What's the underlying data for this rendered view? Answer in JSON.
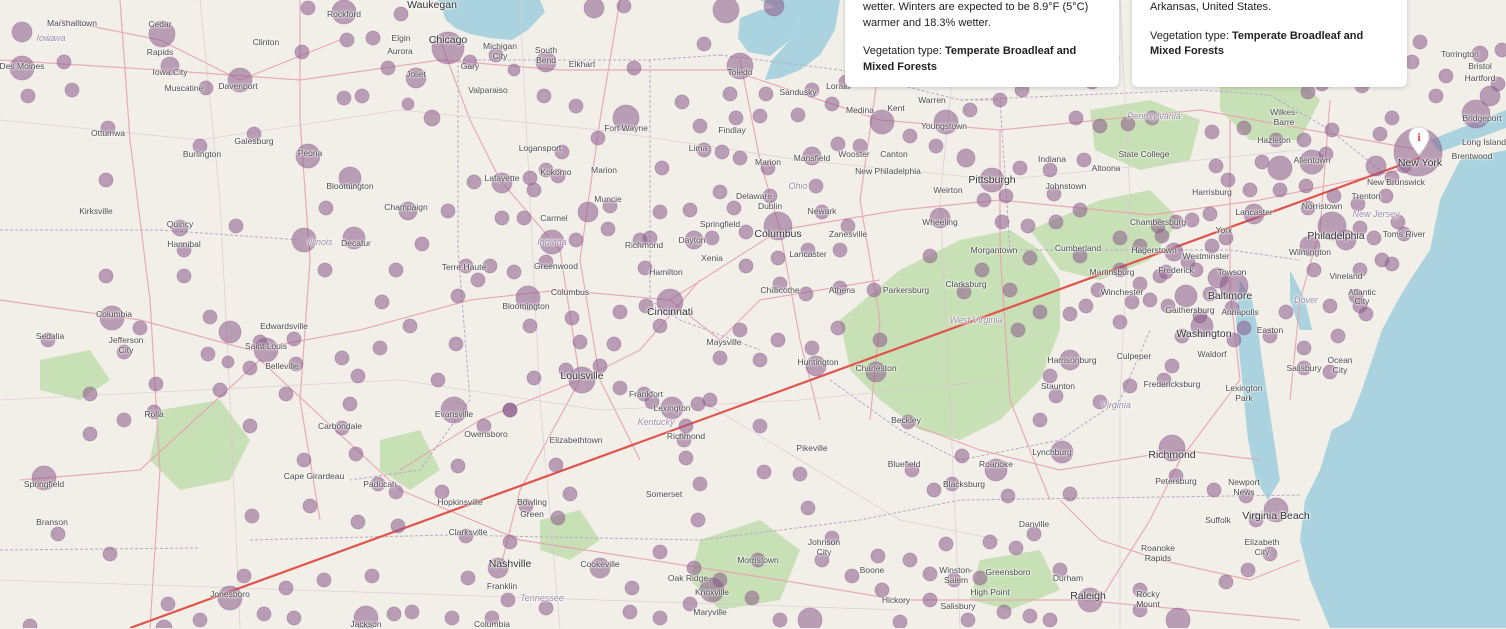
{
  "cards": [
    {
      "line1": "wetter. Winters are expected to be 8.9°F (5°C)",
      "line2": "warmer and 18.3% wetter.",
      "veg_prefix": "Vegetation type: ",
      "veg_bold": "Temperate Broadleaf and Mixed Forests"
    },
    {
      "line1": "Arkansas, United States.",
      "veg_prefix": "Vegetation type: ",
      "veg_bold": "Temperate Broadleaf and Mixed Forests"
    }
  ],
  "pin_icon": "info-marker-icon",
  "route_color": "#e0544d",
  "cluster_color": "#8a5a8a",
  "labels": {
    "big": [
      "Chicago",
      "Columbus",
      "Louisville",
      "Baltimore",
      "Washington",
      "Philadelphia",
      "Richmond",
      "Nashville",
      "Virginia Beach",
      "New York",
      "Cincinnati",
      "Pittsburgh"
    ],
    "small": [
      "Marshalltown",
      "Cedar Rapids",
      "Iowa City",
      "Des Moines",
      "Muscatine",
      "Davenport",
      "Rockford",
      "Elgin",
      "Aurora",
      "Joliet",
      "Gary",
      "Waukegan",
      "Michigan City",
      "South Bend",
      "Elkhart",
      "Valparaiso",
      "Toledo",
      "Fort Wayne",
      "Findlay",
      "Lima",
      "Sandusky",
      "Mansfield",
      "Kent",
      "Youngstown",
      "Canton",
      "Wooster",
      "Medina",
      "Warren",
      "New Philadelphia",
      "Wheeling",
      "Weirton",
      "Indiana",
      "Johnstown",
      "Altoona",
      "State College",
      "Harrisburg",
      "Lancaster",
      "York",
      "Allentown",
      "Trenton",
      "New Brunswick",
      "Wilmington",
      "Hagerstown",
      "Frederick",
      "Towson",
      "Westminster",
      "Gaithersburg",
      "Annapolis",
      "Easton",
      "Waldorf",
      "Dover",
      "Vineland",
      "Atlantic City",
      "Toms River",
      "Brentwood",
      "Long Island",
      "Bridgeport",
      "Torrington",
      "Bristol",
      "Hartford",
      "Wilkes-Barre",
      "Hazleton",
      "Muncie",
      "Marion",
      "Kokomo",
      "Logansport",
      "Lafayette",
      "Carmel",
      "Indiana",
      "Richmond",
      "Dayton",
      "Xenia",
      "Springfield",
      "Hamilton",
      "Greenwood",
      "Terre Haute",
      "Columbus",
      "Bloomington",
      "Champaign",
      "Bloomington",
      "Decatur",
      "Peoria",
      "Galesburg",
      "Burlington",
      "Ottumwa",
      "Kirksville",
      "Quincy",
      "Hannibal",
      "Columbia",
      "Jefferson",
      "Sedalia",
      "Edwardsville",
      "Saint Louis",
      "Belleville",
      "Rolla",
      "Carbondale",
      "Cape Girardeau",
      "Paducah",
      "Springfield",
      "Branson",
      "Jonesboro",
      "Jackson",
      "Columbia",
      "Franklin",
      "Clarksville",
      "Hopkinsville",
      "Bowling Green",
      "Owensboro",
      "Evansville",
      "Elizabethtown",
      "Frankfort",
      "Lexington",
      "Richmond",
      "Kentucky",
      "Somerset",
      "Pikeville",
      "Maysville",
      "Chillicothe",
      "Lancaster",
      "Zanesville",
      "Newark",
      "Athens",
      "Parkersburg",
      "Clarksburg",
      "Morgantown",
      "Cumberland",
      "Martinsburg",
      "Winchester",
      "Culpeper",
      "Harrisonburg",
      "Staunton",
      "Charleston",
      "Huntington",
      "Beckley",
      "Bluefield",
      "Blacksburg",
      "Roanoke",
      "Lynchburg",
      "Danville",
      "Fredericksburg",
      "Petersburg",
      "Suffolk",
      "Newport News",
      "Elizabeth City",
      "Roanoke Rapids",
      "Rocky Mount",
      "Raleigh",
      "Durham",
      "Greensboro",
      "Winston-Salem",
      "High Point",
      "Salisbury",
      "Hickory",
      "Boone",
      "Johnson City",
      "Morristown",
      "Knoxville",
      "Oak Ridge",
      "Maryville",
      "Cookeville",
      "Salisbury",
      "Ocean City",
      "Lexington Park",
      "Delaware",
      "Ohio",
      "Pennsylvania",
      "West Virginia",
      "Tennessee",
      "Virginia",
      "Illinois",
      "Iowa",
      "New Jersey",
      "Lorain"
    ]
  },
  "route": {
    "from": "New York",
    "to": "Arkansas"
  }
}
